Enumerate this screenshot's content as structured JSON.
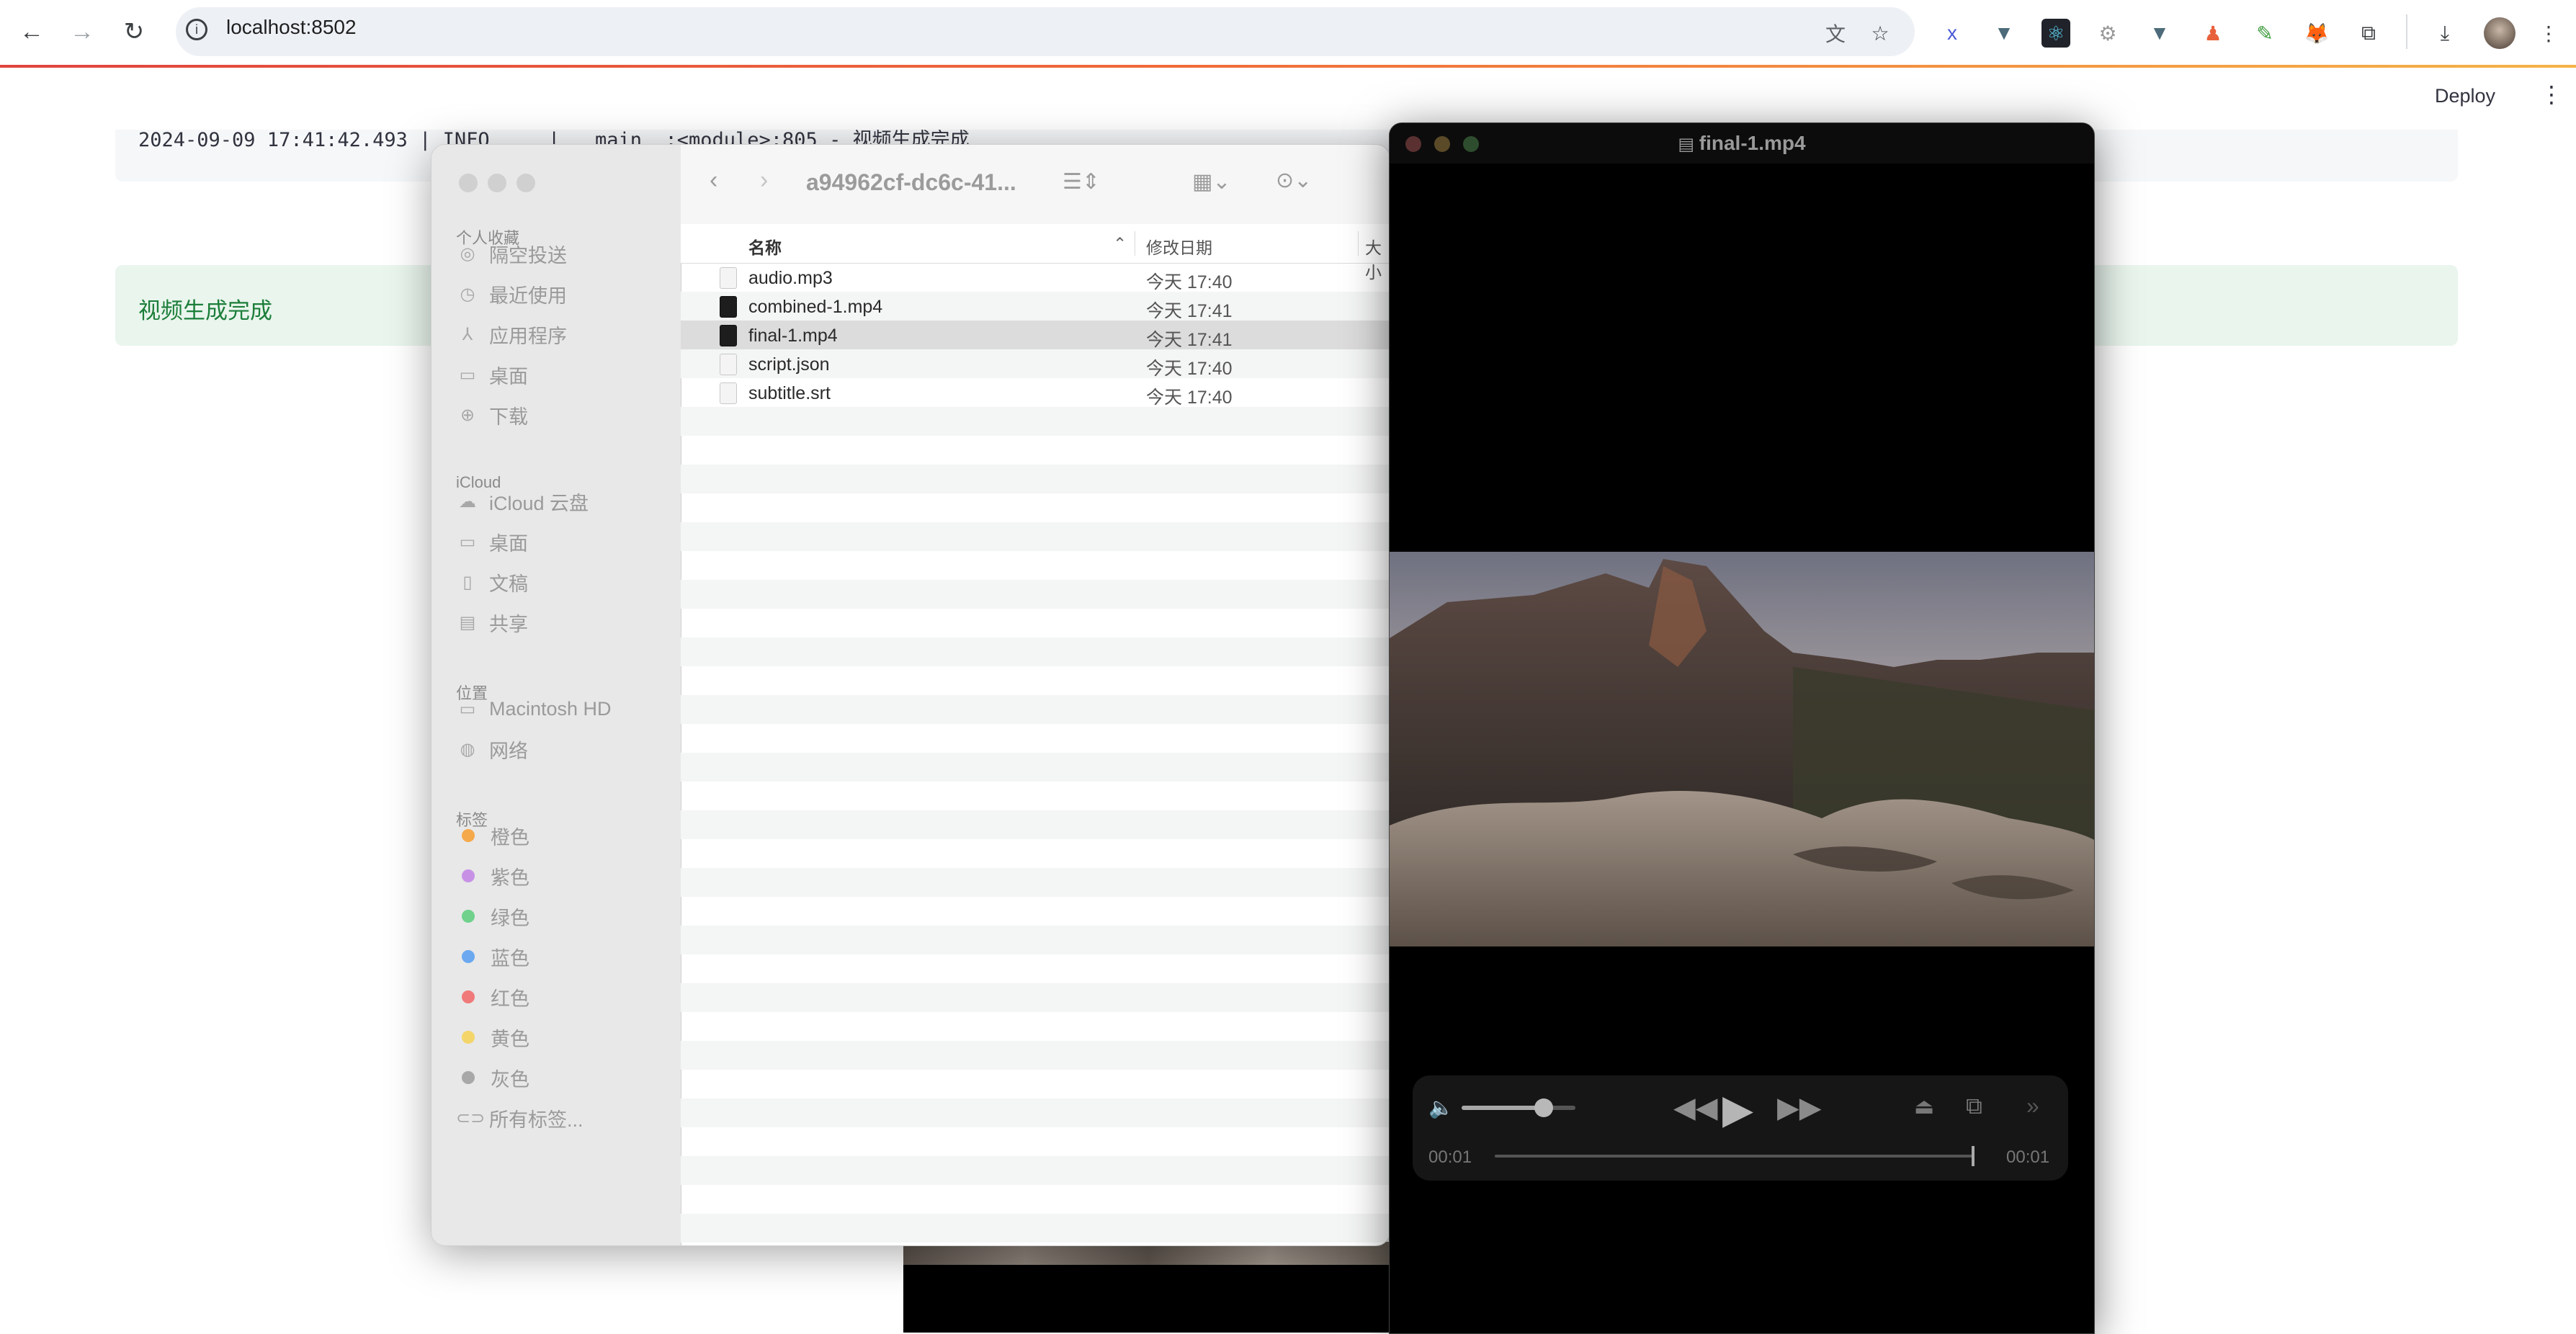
{
  "browser": {
    "url": "localhost:8502",
    "nav": {
      "back_icon": "arrow-left-icon",
      "forward_icon": "arrow-right-icon",
      "reload_icon": "reload-icon"
    }
  },
  "streamlit": {
    "deploy_label": "Deploy",
    "log_line": "2024-09-09 17:41:42.493 | INFO     | __main__:<module>:805 - 视频生成完成",
    "success_text": "视频生成完成"
  },
  "finder": {
    "folder_name": "a94962cf-dc6c-41...",
    "sidebar": {
      "favorites_header": "个人收藏",
      "favorites": [
        "隔空投送",
        "最近使用",
        "应用程序",
        "桌面",
        "下载"
      ],
      "icloud_header": "iCloud",
      "icloud": [
        "iCloud 云盘",
        "桌面",
        "文稿",
        "共享"
      ],
      "locations_header": "位置",
      "locations": [
        "Macintosh HD",
        "网络"
      ],
      "tags_header": "标签",
      "tags": [
        "橙色",
        "紫色",
        "绿色",
        "蓝色",
        "红色",
        "黄色",
        "灰色",
        "所有标签..."
      ],
      "tag_colors": [
        "#f5a94a",
        "#c792e6",
        "#6fd18b",
        "#6ba8f0",
        "#f07a7a",
        "#f3d56a",
        "#a8a8a8"
      ]
    },
    "columns": {
      "name": "名称",
      "date": "修改日期",
      "size": "大小"
    },
    "files": [
      {
        "name": "audio.mp3",
        "date": "今天 17:40"
      },
      {
        "name": "combined-1.mp4",
        "date": "今天 17:41"
      },
      {
        "name": "final-1.mp4",
        "date": "今天 17:41"
      },
      {
        "name": "script.json",
        "date": "今天 17:40"
      },
      {
        "name": "subtitle.srt",
        "date": "今天 17:40"
      }
    ]
  },
  "player": {
    "title": "final-1.mp4",
    "time_elapsed": "00:01",
    "time_remaining": "00:01",
    "volume_level": 0.72,
    "progress": 1.0
  }
}
